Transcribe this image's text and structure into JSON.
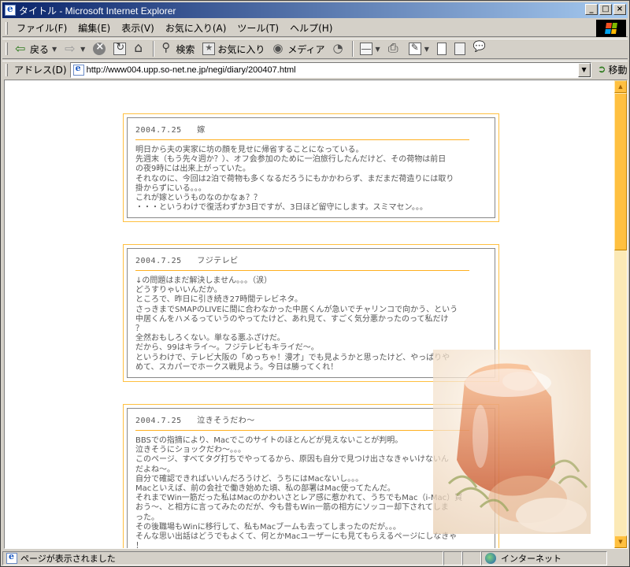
{
  "window": {
    "title": "タイトル - Microsoft Internet Explorer",
    "buttons": {
      "minimize": "_",
      "maximize": "□",
      "close": "×"
    }
  },
  "menu": [
    "ファイル(F)",
    "編集(E)",
    "表示(V)",
    "お気に入り(A)",
    "ツール(T)",
    "ヘルプ(H)"
  ],
  "toolbar": {
    "back_label": "戻る",
    "search_label": "検索",
    "favorites_label": "お気に入り",
    "media_label": "メディア"
  },
  "address": {
    "label": "アドレス(D)",
    "url": "http://www004.upp.so-net.ne.jp/negi/diary/200407.html",
    "go_label": "移動"
  },
  "entries": [
    {
      "date": "2004.7.25",
      "title": "嫁",
      "lines": [
        "明日から夫の実家に坊の顔を見せに帰省することになっている。",
        "先週末（もう先々週か？）、オフ会参加のために一泊旅行したんだけど、その荷物は前日",
        "の夜9時には出来上がっていた。",
        "それなのに、今回は2泊で荷物も多くなるだろうにもかかわらず、まだまだ荷造りには取り",
        "掛からずにいる。。。",
        "これが嫁というものなのかなぁ？？",
        "・・・というわけで復活わずか3日ですが、3日ほど留守にします。スミマセン。。。"
      ]
    },
    {
      "date": "2004.7.25",
      "title": "フジテレビ",
      "lines": [
        "↓の問題はまだ解決しません。。。（涙）",
        "どうすりゃいいんだか。",
        "ところで、昨日に引き続き27時間テレビネタ。",
        "さっきまでSMAPのLIVEに間に合わなかった中居くんが急いでチャリンコで向かう、という",
        "中居くんをハメるっていうのやってたけど、あれ見て、すごく気分悪かったのって私だけ",
        "？",
        "全然おもしろくない。単なる悪ふざけだ。",
        "だから、99はキライ～。フジテレビもキライだ～。",
        "というわけで、テレビ大阪の「めっちゃ！漫才」でも見ようかと思ったけど、やっぱりや",
        "めて、スカパーでホークス戦見よう。今日は勝ってくれ！"
      ]
    },
    {
      "date": "2004.7.25",
      "title": "泣きそうだわ～",
      "lines": [
        "BBSでの指摘により、Macでこのサイトのほとんどが見えないことが判明。",
        "泣きそうにショックだわ～。。。",
        "このページ、すべてタグ打ちでやってるから、原因も自分で見つけ出さなきゃいけないん",
        "だよね～。",
        "自分で確認できればいいんだろうけど、うちにはMacないし。。。",
        "Macといえば、前の会社で働き始めた頃、私の部署はMac使ってたんだ。",
        "それまでWin一筋だった私はMacのかわいさとレア感に惹かれて、うちでもMac（i-Mac）買",
        "おう～、と相方に言ってみたのだが、今も昔もWin一筋の相方にソッコー却下されてしま",
        "った。",
        "その後職場もWinに移行して、私もMacブームも去ってしまったのだが。。。",
        "そんな思い出話はどうでもよくて、何とかMacユーザーにも見てもらえるページにしなきゃ",
        "！"
      ]
    }
  ],
  "status": {
    "text": "ページが表示されました",
    "zone": "インターネット"
  },
  "colors": {
    "accent_border": "#ffc040",
    "scrollbar": "#ffc040",
    "titlebar_start": "#0a246a"
  }
}
